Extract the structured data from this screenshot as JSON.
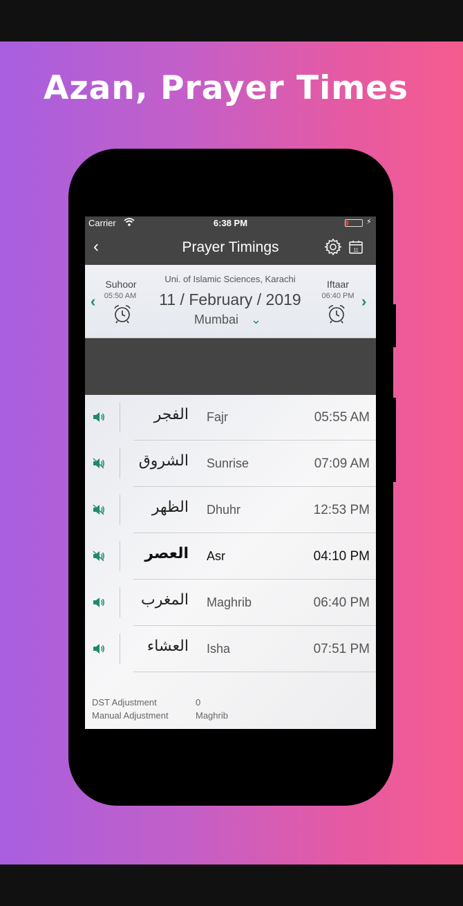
{
  "promo": {
    "title": "Azan, Prayer Times"
  },
  "status": {
    "carrier": "Carrier",
    "time": "6:38 PM"
  },
  "nav": {
    "back": "‹",
    "title": "Prayer Timings"
  },
  "header": {
    "suhoor_label": "Suhoor",
    "suhoor_time": "05:50 AM",
    "iftaar_label": "Iftaar",
    "iftaar_time": "06:40 PM",
    "school": "Uni. of Islamic Sciences, Karachi",
    "date": "11 / February / 2019",
    "city": "Mumbai",
    "prev": "‹",
    "next": "›",
    "city_chevron": "⌄"
  },
  "prayers": [
    {
      "arabic": "الفجر",
      "name": "Fajr",
      "time": "05:55 AM",
      "sound": "on",
      "active": false
    },
    {
      "arabic": "الشروق",
      "name": "Sunrise",
      "time": "07:09 AM",
      "sound": "muted",
      "active": false
    },
    {
      "arabic": "الظهر",
      "name": "Dhuhr",
      "time": "12:53 PM",
      "sound": "muted",
      "active": false
    },
    {
      "arabic": "العصر",
      "name": "Asr",
      "time": "04:10 PM",
      "sound": "muted",
      "active": true
    },
    {
      "arabic": "المغرب",
      "name": "Maghrib",
      "time": "06:40 PM",
      "sound": "on",
      "active": false
    },
    {
      "arabic": "العشاء",
      "name": "Isha",
      "time": "07:51 PM",
      "sound": "on",
      "active": false
    }
  ],
  "footer": {
    "dst_label": "DST Adjustment",
    "dst_value": "0",
    "manual_label": "Manual Adjustment",
    "manual_value": "Maghrib"
  },
  "colors": {
    "accent": "#1f8a6a",
    "bar": "#444444",
    "gradient_start": "#a85fe0",
    "gradient_end": "#f55c8e"
  },
  "icons": {
    "settings": "gear-icon",
    "calendar": "calendar-icon",
    "alarm": "alarm-clock-icon",
    "speaker": "speaker-icon"
  }
}
